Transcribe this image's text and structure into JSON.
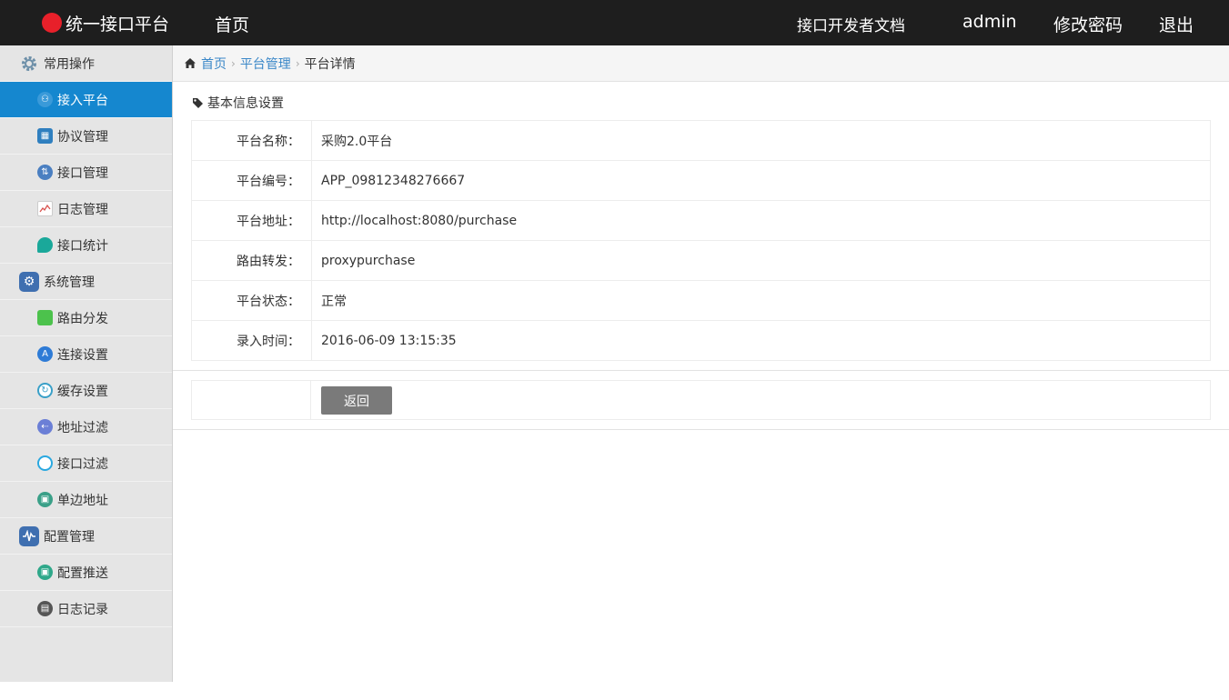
{
  "topbar": {
    "brand": "统一接口平台",
    "home": "首页",
    "doc": "接口开发者文档",
    "user": "admin",
    "change_password": "修改密码",
    "logout": "退出"
  },
  "sidebar": {
    "groups": [
      {
        "label": "常用操作",
        "icon": "gear-icon",
        "color": "#6d8fa8",
        "items": [
          {
            "label": "接入平台",
            "icon": "person-icon",
            "color": "#3a9ad9",
            "active": true
          },
          {
            "label": "协议管理",
            "icon": "book-icon",
            "color": "#2f7fbf"
          },
          {
            "label": "接口管理",
            "icon": "updown-arrows-icon",
            "color": "#4a7fc1"
          },
          {
            "label": "日志管理",
            "icon": "line-chart-icon",
            "color": "#d9534f"
          },
          {
            "label": "接口统计",
            "icon": "pie-chart-icon",
            "color": "#1aa89a"
          }
        ]
      },
      {
        "label": "系统管理",
        "icon": "settings-icon",
        "color": "#3f6fb0",
        "items": [
          {
            "label": "路由分发",
            "icon": "shopping-bag-icon",
            "color": "#4cc24c"
          },
          {
            "label": "连接设置",
            "icon": "app-store-icon",
            "color": "#2e7bd6"
          },
          {
            "label": "缓存设置",
            "icon": "cache-icon",
            "color": "#3aa0c8"
          },
          {
            "label": "地址过滤",
            "icon": "left-arrow-icon",
            "color": "#6b7fd6"
          },
          {
            "label": "接口过滤",
            "icon": "ring-icon",
            "color": "#2aa8e0"
          },
          {
            "label": "单边地址",
            "icon": "monitor-icon",
            "color": "#3aa088"
          }
        ]
      },
      {
        "label": "配置管理",
        "icon": "pulse-icon",
        "color": "#3f6fb0",
        "items": [
          {
            "label": "配置推送",
            "icon": "screen-icon",
            "color": "#2fa88a"
          },
          {
            "label": "日志记录",
            "icon": "disk-icon",
            "color": "#555555"
          }
        ]
      }
    ]
  },
  "breadcrumb": {
    "home": "首页",
    "parent": "平台管理",
    "current": "平台详情"
  },
  "main": {
    "section_title": "基本信息设置",
    "fields": [
      {
        "label": "平台名称：",
        "value": "采购2.0平台"
      },
      {
        "label": "平台编号：",
        "value": "APP_09812348276667"
      },
      {
        "label": "平台地址：",
        "value": "http://localhost:8080/purchase"
      },
      {
        "label": "路由转发：",
        "value": "proxypurchase"
      },
      {
        "label": "平台状态：",
        "value": "正常"
      },
      {
        "label": "录入时间：",
        "value": "2016-06-09 13:15:35"
      }
    ],
    "back_button": "返回"
  }
}
